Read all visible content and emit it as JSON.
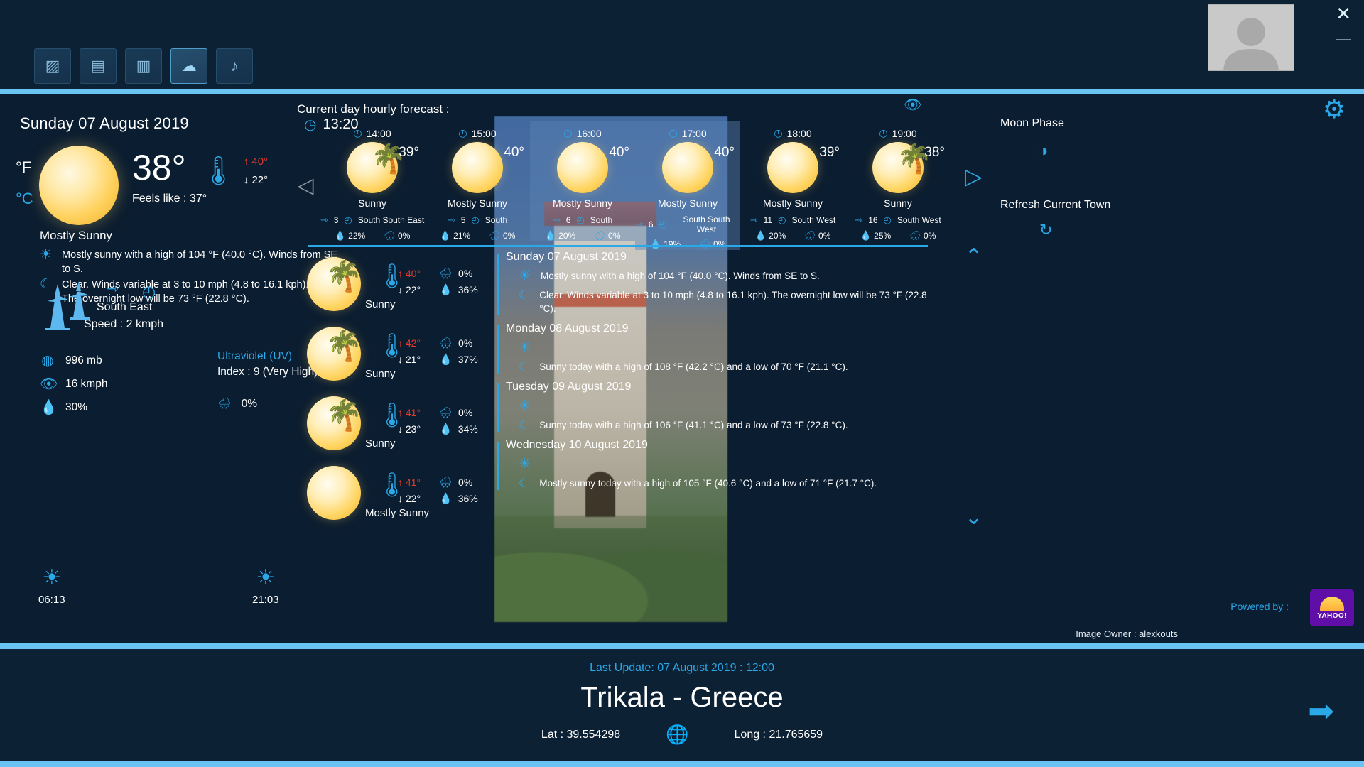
{
  "window": {
    "close_icon": "close-icon",
    "minimize_icon": "minimize-icon",
    "avatar": "user-avatar"
  },
  "toolbar": {
    "buttons": [
      {
        "name": "photos",
        "glyph": "▨"
      },
      {
        "name": "news",
        "glyph": "▤"
      },
      {
        "name": "stats",
        "glyph": "▥"
      },
      {
        "name": "weather",
        "glyph": "☁"
      },
      {
        "name": "music",
        "glyph": "♪"
      }
    ],
    "active_index": 3
  },
  "left": {
    "date": "Sunday 07 August 2019",
    "clock_icon": "clock-icon",
    "time": "13:20",
    "unit_fahrenheit": "°F",
    "unit_celsius": "°C",
    "temperature": "38°",
    "feels_like": "Feels like : 37°",
    "high": "40°",
    "low": "22°",
    "condition": "Mostly Sunny",
    "day_description": "Mostly sunny with a high of 104 °F (40.0 °C). Winds from SE to S.",
    "night_description": "Clear. Winds variable at 3 to 10 mph (4.8 to 16.1 kph). The overnight low will be 73 °F (22.8 °C).",
    "wind_direction": "South East",
    "wind_speed": "Speed : 2 kmph",
    "pressure": "996 mb",
    "visibility": "16  kmph",
    "humidity": "30%",
    "uv_title": "Ultraviolet (UV)",
    "uv_index": "Index : 9 (Very High)",
    "precipitation": "0%",
    "sunrise": "06:13",
    "sunset": "21:03"
  },
  "hourly": {
    "label": "Current day hourly forecast :",
    "prev_icon": "chevron-left-icon",
    "highlight_index": 2,
    "cards": [
      {
        "time": "14:00",
        "temp": "39°",
        "condition": "Sunny",
        "icon": "sun-palm-icon",
        "wind": "3",
        "direction": "South South East",
        "humidity": "22%",
        "precipitation": "0%"
      },
      {
        "time": "15:00",
        "temp": "40°",
        "condition": "Mostly Sunny",
        "icon": "sun-icon",
        "wind": "5",
        "direction": "South",
        "humidity": "21%",
        "precipitation": "0%"
      },
      {
        "time": "16:00",
        "temp": "40°",
        "condition": "Mostly Sunny",
        "icon": "sun-icon",
        "wind": "6",
        "direction": "South",
        "humidity": "20%",
        "precipitation": "0%"
      },
      {
        "time": "17:00",
        "temp": "40°",
        "condition": "Mostly Sunny",
        "icon": "sun-icon",
        "wind": "6",
        "direction": "South South West",
        "humidity": "19%",
        "precipitation": "0%"
      },
      {
        "time": "18:00",
        "temp": "39°",
        "condition": "Mostly Sunny",
        "icon": "sun-icon",
        "wind": "11",
        "direction": "South West",
        "humidity": "20%",
        "precipitation": "0%"
      },
      {
        "time": "19:00",
        "temp": "38°",
        "condition": "Sunny",
        "icon": "sun-palm-icon",
        "wind": "16",
        "direction": "South West",
        "humidity": "25%",
        "precipitation": "0%"
      }
    ]
  },
  "daily": [
    {
      "icon": "sun-palm-icon",
      "high": "40°",
      "low": "22°",
      "precipitation": "0%",
      "humidity": "36%",
      "condition": "Sunny"
    },
    {
      "icon": "sun-palm-icon",
      "high": "42°",
      "low": "21°",
      "precipitation": "0%",
      "humidity": "37%",
      "condition": "Sunny"
    },
    {
      "icon": "sun-palm-icon",
      "high": "41°",
      "low": "23°",
      "precipitation": "0%",
      "humidity": "34%",
      "condition": "Sunny"
    },
    {
      "icon": "sun-icon",
      "high": "41°",
      "low": "22°",
      "precipitation": "0%",
      "humidity": "36%",
      "condition": "Mostly Sunny"
    }
  ],
  "details": [
    {
      "date": "Sunday 07 August 2019",
      "day": "Mostly sunny with a high of 104 °F (40.0 °C). Winds from SE to S.",
      "night": "Clear. Winds variable at 3 to 10 mph (4.8 to 16.1 kph). The overnight low will be 73 °F (22.8 °C)."
    },
    {
      "date": "Monday 08 August 2019",
      "day": "",
      "night": "Sunny today with a high of 108 °F (42.2 °C) and a low of 70 °F (21.1 °C)."
    },
    {
      "date": "Tuesday 09 August 2019",
      "day": "",
      "night": "Sunny today with a high of 106 °F (41.1 °C) and a low of 73 °F (22.8 °C)."
    },
    {
      "date": "Wednesday 10 August 2019",
      "day": "",
      "night": "Mostly sunny today with a high of 105 °F (40.6 °C) and a low of 71 °F (21.7 °C)."
    }
  ],
  "image_owner": "Image Owner : alexkouts",
  "right": {
    "eye_icon": "eye-icon",
    "settings_icon": "gear-icon",
    "moon_phase_label": "Moon Phase",
    "moon_glyph": "◑",
    "refresh_label": "Refresh Current Town",
    "refresh_glyph": "↻",
    "next_icon": "chevron-right-icon",
    "scroll_up_icon": "chevron-up-icon",
    "scroll_down_icon": "chevron-down-icon",
    "powered_by": "Powered by :",
    "provider": "YAHOO!"
  },
  "footer": {
    "last_update": "Last Update:  07 August 2019 : 12:00",
    "city": "Trikala - Greece",
    "lat": "Lat : 39.554298",
    "long": "Long : 21.765659",
    "globe_icon": "globe-icon",
    "next_arrow": "arrow-right-icon"
  }
}
